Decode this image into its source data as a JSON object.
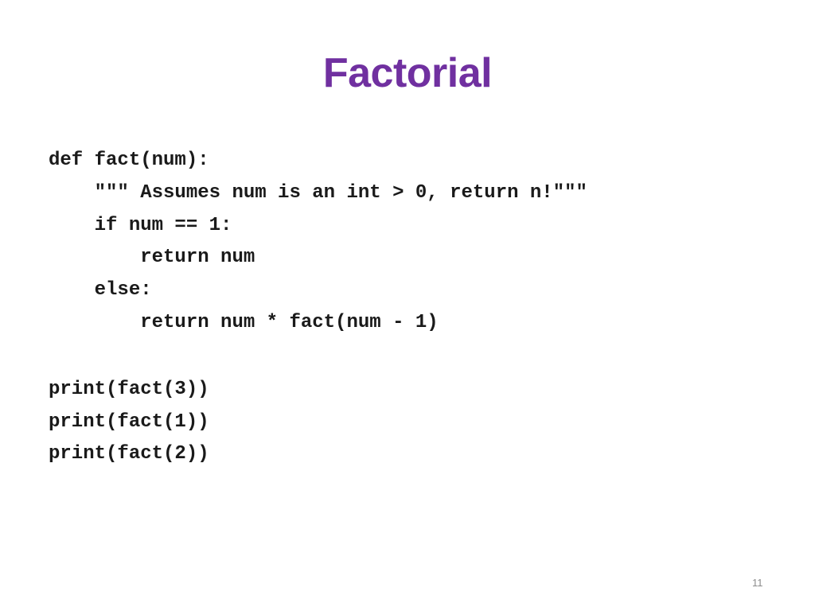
{
  "slide": {
    "title": "Factorial",
    "code_lines": [
      "def fact(num):",
      "    \"\"\" Assumes num is an int > 0, return n!\"\"\"",
      "    if num == 1:",
      "        return num",
      "    else:",
      "        return num * fact(num - 1)",
      "",
      "print(fact(3))",
      "print(fact(1))",
      "print(fact(2))"
    ],
    "page_number": "11",
    "title_color": "#7030a0"
  }
}
